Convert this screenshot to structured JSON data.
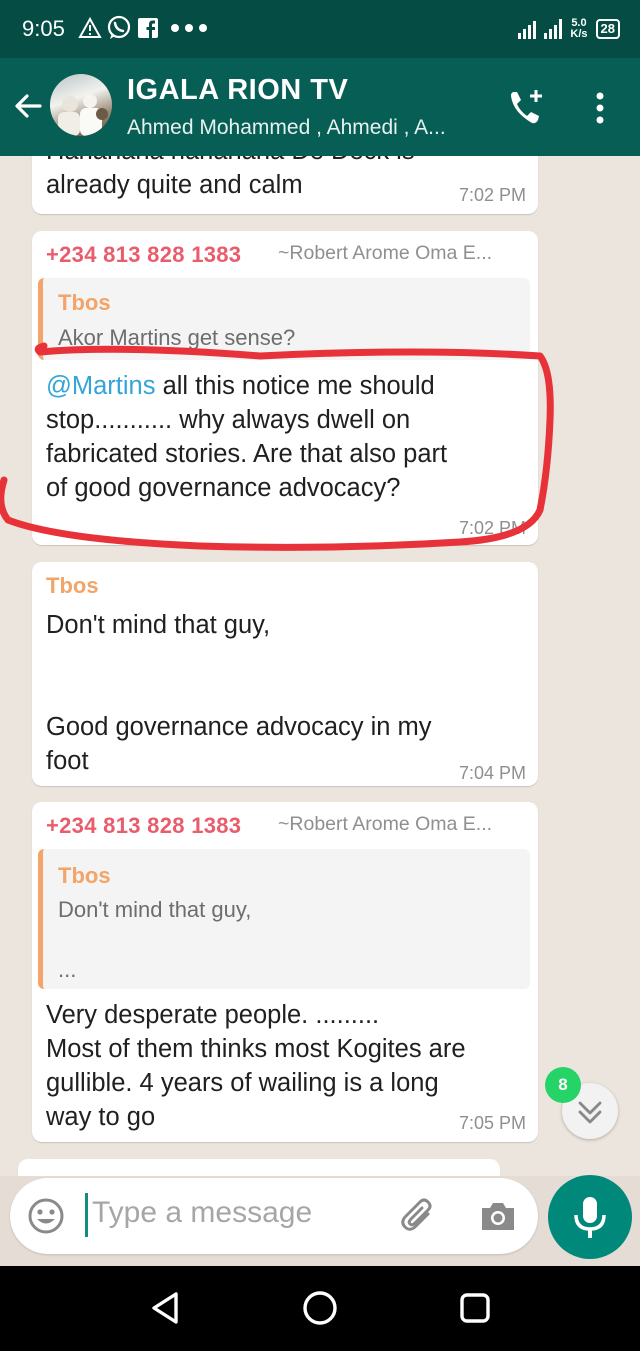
{
  "status_bar": {
    "time": "9:05",
    "network_speed_value": "5.0",
    "network_speed_unit": "K/s",
    "battery": "28",
    "icons": [
      "alert-triangle-icon",
      "whatsapp-icon",
      "facebook-icon",
      "more-dots-icon",
      "signal-icon",
      "battery-icon"
    ]
  },
  "header": {
    "title": "IGALA RION TV",
    "subtitle": "Ahmed Mohammed , Ahmedi , A...",
    "icons": [
      "back-arrow-icon",
      "group-avatar",
      "add-call-icon",
      "more-vert-icon"
    ]
  },
  "messages": [
    {
      "partial_top": "Hahahaha hahahaha De Deck is",
      "text": "already quite and calm",
      "time": "7:02 PM"
    },
    {
      "sender": "+234 813 828 1383",
      "alias": "~Robert Arome Oma E...",
      "quote_name": "Tbos",
      "quote_text": "Akor Martins get sense?",
      "mention": "@Martins",
      "text_lines": [
        " all this notice me should",
        "stop........... why always dwell on",
        "fabricated stories. Are that also part",
        "of good governance advocacy?"
      ],
      "time": "7:02 PM"
    },
    {
      "sender": "Tbos",
      "text_lines": [
        "Don't mind that guy,",
        "",
        "",
        "Good governance advocacy in my",
        "foot"
      ],
      "time": "7:04 PM"
    },
    {
      "sender": "+234 813 828 1383",
      "alias": "~Robert Arome Oma E...",
      "quote_name": "Tbos",
      "quote_text_lines": [
        "Don't mind that guy,",
        "",
        "..."
      ],
      "text_lines": [
        "Very desperate people. .........",
        "Most of them thinks most Kogites are",
        "gullible. 4 years of wailing is a long",
        "way to go"
      ],
      "time": "7:05 PM"
    }
  ],
  "unread_badge": "8",
  "input": {
    "placeholder": "Type a message"
  },
  "colors": {
    "header_bg": "#075e54",
    "statusbar_bg": "#054d44",
    "sender_color": "#e85c6c",
    "quote_name_color": "#f2a469",
    "mention_color": "#35a4d8",
    "mic_button": "#00897b",
    "annotation_red": "#e8323a"
  }
}
